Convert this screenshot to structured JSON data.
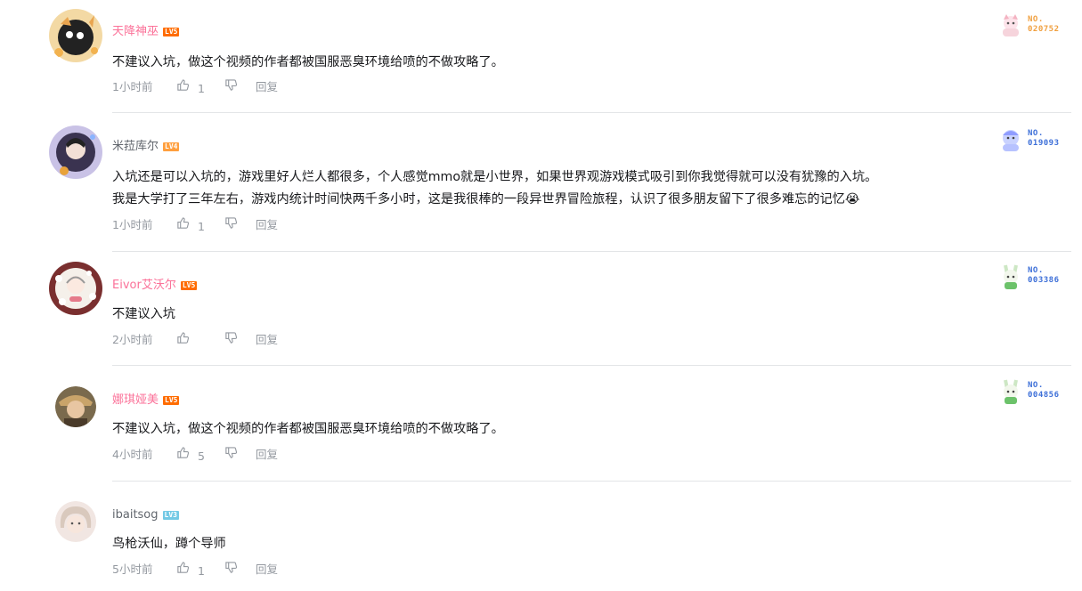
{
  "colors": {
    "name_pink": "#fb7299",
    "name_gray": "#61666d",
    "meta": "#9499a0",
    "lv5": "#ff6c00",
    "lv4": "#ff9f3e",
    "lv3": "#73c9e5"
  },
  "comments": [
    {
      "username": "天降神巫",
      "level": "LV5",
      "text": "不建议入坑，做这个视频的作者都被国服恶臭环境给喷的不做攻略了。",
      "time": "1小时前",
      "likes": "1",
      "reply": "回复",
      "fan_no_label": "NO.",
      "fan_no": "020752"
    },
    {
      "username": "米菈库尔",
      "level": "LV4",
      "text_lines": [
        "入坑还是可以入坑的，游戏里好人烂人都很多，个人感觉mmo就是小世界，如果世界观游戏模式吸引到你我觉得就可以没有犹豫的入坑。",
        "我是大学打了三年左右，游戏内统计时间快两千多小时，这是我很棒的一段异世界冒险旅程，认识了很多朋友留下了很多难忘的记忆😭"
      ],
      "time": "1小时前",
      "likes": "1",
      "reply": "回复",
      "fan_no_label": "NO.",
      "fan_no": "019093"
    },
    {
      "username": "Eivor艾沃尔",
      "level": "LV5",
      "text": "不建议入坑",
      "time": "2小时前",
      "likes": "",
      "reply": "回复",
      "fan_no_label": "NO.",
      "fan_no": "003386"
    },
    {
      "username": "娜琪娅美",
      "level": "LV5",
      "text": "不建议入坑，做这个视频的作者都被国服恶臭环境给喷的不做攻略了。",
      "time": "4小时前",
      "likes": "5",
      "reply": "回复",
      "fan_no_label": "NO.",
      "fan_no": "004856"
    },
    {
      "username": "ibaitsog",
      "level": "LV3",
      "text": "鸟枪沃仙，蹲个导师",
      "time": "5小时前",
      "likes": "1",
      "reply": "回复"
    }
  ]
}
